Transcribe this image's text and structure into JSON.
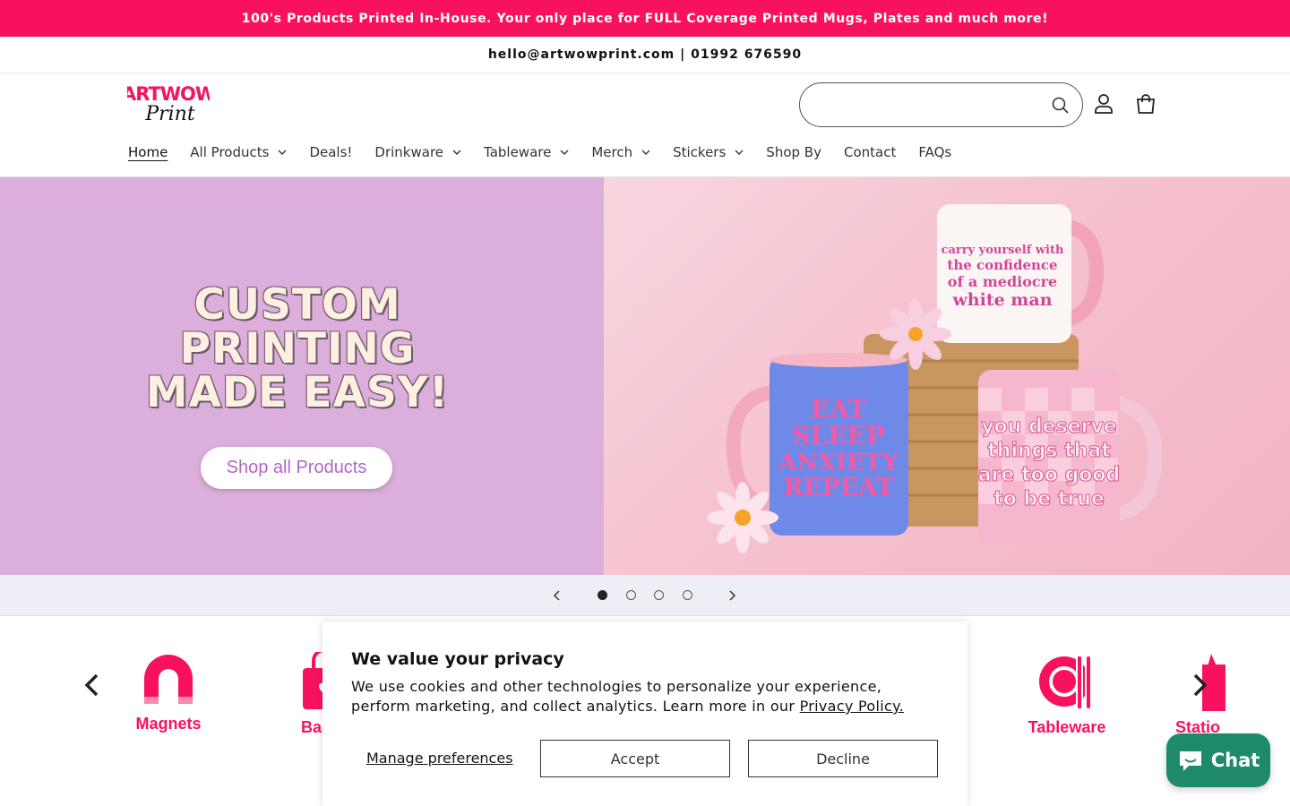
{
  "announcement": "100's Products Printed In-House. Your only place for FULL Coverage Printed Mugs, Plates and much more!",
  "contact_line": "hello@artwowprint.com | 01992 676590",
  "logo": {
    "top": "ARTWOW",
    "script": "Print"
  },
  "search": {
    "placeholder": "",
    "value": ""
  },
  "nav": {
    "home": "Home",
    "all_products": "All Products",
    "deals": "Deals!",
    "drinkware": "Drinkware",
    "tableware": "Tableware",
    "merch": "Merch",
    "stickers": "Stickers",
    "shop_by": "Shop By",
    "contact": "Contact",
    "faqs": "FAQs"
  },
  "hero": {
    "line1": "CUSTOM",
    "line2": "PRINTING",
    "line3": "MADE EASY!",
    "button": "Shop all Products",
    "mug1": "EAT SLEEP ANXIETY REPEAT",
    "mug2": "you deserve things that are too good to be true",
    "mug3": "carry yourself with the confidence of a mediocre white man"
  },
  "slider": {
    "total": 4,
    "active": 1
  },
  "categories": [
    {
      "label": "Magnets"
    },
    {
      "label": "Bag"
    },
    {
      "label": "Tableware"
    },
    {
      "label": "Statio"
    }
  ],
  "cookie": {
    "title": "We value your privacy",
    "body": "We use cookies and other technologies to personalize your experience, perform marketing, and collect analytics. Learn more in our",
    "link": "Privacy Policy.",
    "manage": "Manage preferences",
    "accept": "Accept",
    "decline": "Decline"
  },
  "chat": {
    "label": "Chat"
  },
  "colors": {
    "brand_pink": "#f8125e",
    "hero_lilac": "#dcaedb",
    "chat_green": "#1f8a6b"
  }
}
